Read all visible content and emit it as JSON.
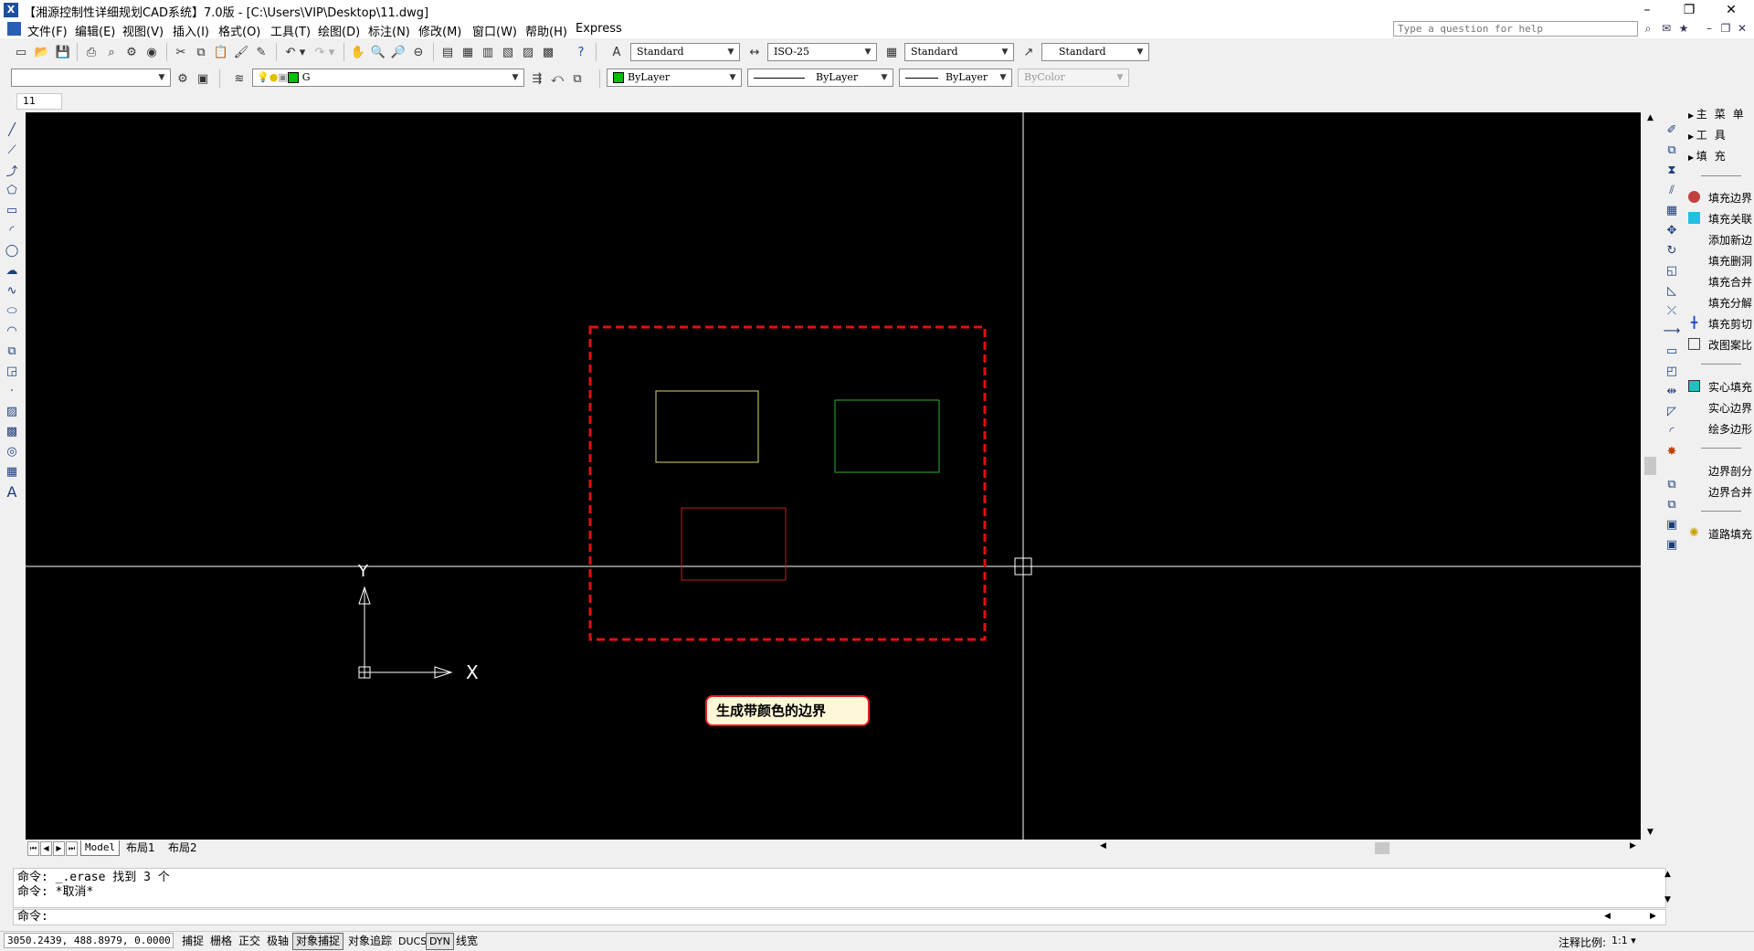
{
  "window": {
    "title": "【湘源控制性详细规划CAD系统】7.0版 - [C:\\Users\\VIP\\Desktop\\11.dwg]",
    "app_icon_label": "X",
    "minimize": "–",
    "restore": "❐",
    "close": "✕"
  },
  "menu": {
    "items": [
      "文件(F)",
      "编辑(E)",
      "视图(V)",
      "插入(I)",
      "格式(O)",
      "工具(T)",
      "绘图(D)",
      "标注(N)",
      "修改(M)",
      "窗口(W)",
      "帮助(H)",
      "Express"
    ],
    "help_placeholder": "Type a question for help",
    "doc_minimize": "–",
    "doc_restore": "❐",
    "doc_close": "✕"
  },
  "toolbar": {
    "text_style": "Standard",
    "dim_style": "ISO-25",
    "table_style": "Standard",
    "multileader_style": "Standard",
    "workspace": "",
    "layer": "G",
    "color": "ByLayer",
    "linetype": "ByLayer",
    "lineweight": "ByLayer",
    "plotstyle": "ByColor",
    "small_field": "11"
  },
  "canvas": {
    "background": "#000000",
    "tooltip_text": "生成带颜色的边界",
    "ucs_x_label": "X",
    "ucs_y_label": "Y",
    "shapes": [
      {
        "name": "red-dashed-boundary",
        "color": "#e01010"
      },
      {
        "name": "yellow-rectangle",
        "color": "#d8d870"
      },
      {
        "name": "green-rectangle",
        "color": "#30b030"
      },
      {
        "name": "red-rectangle",
        "color": "#b82020"
      }
    ]
  },
  "tabs": {
    "items": [
      "Model",
      "布局1",
      "布局2"
    ],
    "active": "Model"
  },
  "right_menu": {
    "headers": [
      "主菜单",
      "工具",
      "填充"
    ],
    "group1": [
      "填充边界",
      "填充关联",
      "添加新边",
      "填充删洞",
      "填充合并",
      "填充分解",
      "填充剪切",
      "改图案比"
    ],
    "group2": [
      "实心填充",
      "实心边界",
      "绘多边形"
    ],
    "group3": [
      "边界剖分",
      "边界合并"
    ],
    "group4": [
      "道路填充"
    ]
  },
  "command": {
    "line1": "命令: _.erase 找到 3 个",
    "line2": "命令: *取消*",
    "prompt": "命令:"
  },
  "status": {
    "coords": "3050.2439, 488.8979, 0.0000",
    "buttons": [
      {
        "label": "捕捉",
        "on": false
      },
      {
        "label": "栅格",
        "on": false
      },
      {
        "label": "正交",
        "on": false
      },
      {
        "label": "极轴",
        "on": false
      },
      {
        "label": "对象捕捉",
        "on": true
      },
      {
        "label": "对象追踪",
        "on": false
      },
      {
        "label": "DUCS",
        "on": false
      },
      {
        "label": "DYN",
        "on": true
      },
      {
        "label": "线宽",
        "on": false
      }
    ],
    "scale_label": "注释比例:",
    "scale_value": "1:1 ▾"
  }
}
